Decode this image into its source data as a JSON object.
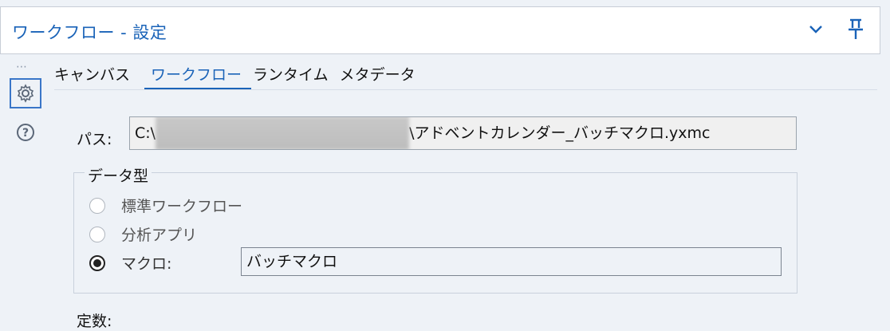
{
  "header": {
    "title": "ワークフロー - 設定",
    "icons": {
      "collapse": "chevron-down-icon",
      "pin": "pin-icon"
    }
  },
  "rail": {
    "grip": "⋯",
    "items": [
      {
        "name": "gear-icon",
        "active": true
      },
      {
        "name": "help-icon",
        "active": false
      }
    ]
  },
  "tabs": [
    {
      "label": "キャンバス",
      "active": false
    },
    {
      "label": "ワークフロー",
      "active": true
    },
    {
      "label": "ランタイム",
      "active": false
    },
    {
      "label": "メタデータ",
      "active": false
    }
  ],
  "path": {
    "label": "パス:",
    "prefix": "C:\\",
    "suffix": "\\アドベントカレンダー_バッチマクロ.yxmc"
  },
  "data_type": {
    "legend": "データ型",
    "options": [
      {
        "label": "標準ワークフロー",
        "checked": false
      },
      {
        "label": "分析アプリ",
        "checked": false
      },
      {
        "label": "マクロ:",
        "checked": true
      }
    ],
    "macro_value": "バッチマクロ"
  },
  "constants": {
    "label": "定数:"
  },
  "colors": {
    "accent": "#1a63b8",
    "background": "#eef2f7"
  }
}
